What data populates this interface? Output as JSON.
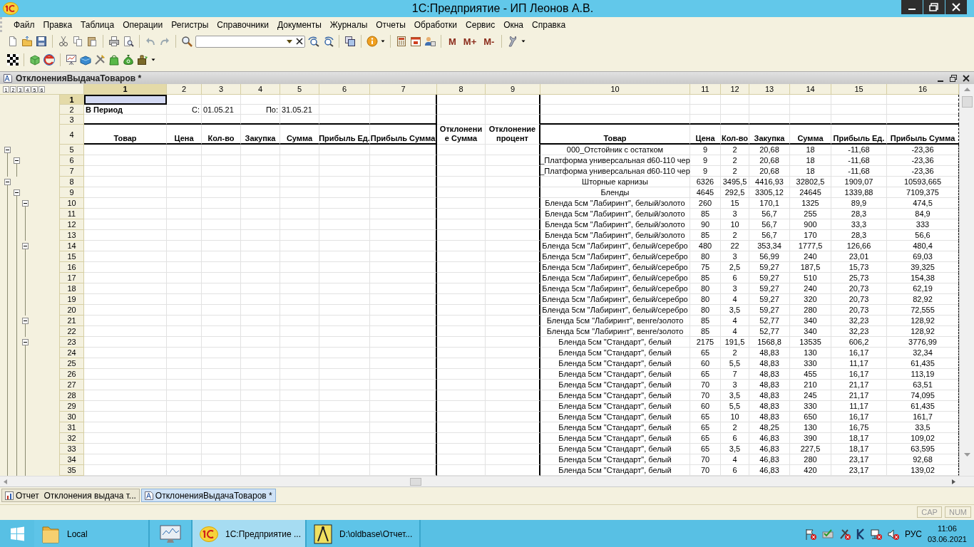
{
  "window": {
    "title": "1С:Предприятие - ИП Леонов А.В."
  },
  "menu": [
    "Файл",
    "Правка",
    "Таблица",
    "Операции",
    "Регистры",
    "Справочники",
    "Документы",
    "Журналы",
    "Отчеты",
    "Обработки",
    "Сервис",
    "Окна",
    "Справка"
  ],
  "toolbar": {
    "memory_buttons": [
      "M",
      "M+",
      "M-"
    ]
  },
  "document": {
    "title": "ОтклоненияВыдачаТоваров *",
    "outline_levels": [
      "1",
      "2",
      "3",
      "4",
      "5",
      "6"
    ],
    "columns": [
      {
        "label": "1",
        "selected": true
      },
      {
        "label": "2",
        "selected": false
      },
      {
        "label": "3",
        "selected": false
      },
      {
        "label": "4",
        "selected": false
      },
      {
        "label": "5",
        "selected": false
      },
      {
        "label": "6",
        "selected": false
      },
      {
        "label": "7",
        "selected": false
      },
      {
        "label": "8",
        "selected": false
      },
      {
        "label": "9",
        "selected": false
      },
      {
        "label": "10",
        "selected": false
      },
      {
        "label": "11",
        "selected": false
      },
      {
        "label": "12",
        "selected": false
      },
      {
        "label": "13",
        "selected": false
      },
      {
        "label": "14",
        "selected": false
      },
      {
        "label": "15",
        "selected": false
      },
      {
        "label": "16",
        "selected": false
      }
    ],
    "rows": [
      {
        "n": "1",
        "kind": "blank",
        "selected": true
      },
      {
        "n": "2",
        "kind": "period",
        "selected": false,
        "cells": {
          "1": "В Период",
          "2": "С:",
          "3": "01.05.21",
          "4": "По:",
          "5": "31.05.21"
        }
      },
      {
        "n": "3",
        "kind": "blank",
        "selected": false
      },
      {
        "n": "4",
        "kind": "header",
        "selected": false,
        "cells": {
          "1": "Товар",
          "2": "Цена",
          "3": "Кол-во",
          "4": "Закупка",
          "5": "Сумма",
          "6": "Прибыль Ед.",
          "7": "Прибыль Сумма",
          "8": "Отклонение Сумма",
          "9": "Отклонение процент",
          "10": "Товар",
          "11": "Цена",
          "12": "Кол-во",
          "13": "Закупка",
          "14": "Сумма",
          "15": "Прибыль Ед.",
          "16": "Прибыль Сумма"
        }
      },
      {
        "n": "5",
        "kind": "data",
        "selected": false,
        "cells": {
          "10": "000_Отстойник с остатком",
          "11": "9",
          "12": "2",
          "13": "20,68",
          "14": "18",
          "15": "-11,68",
          "16": "-23,36"
        },
        "expanded": true,
        "children": [
          {
            "n": "6",
            "kind": "data",
            "selected": false,
            "cells": {
              "10": "_Платформа универсальная d60-110 чер",
              "11": "9",
              "12": "2",
              "13": "20,68",
              "14": "18",
              "15": "-11,68",
              "16": "-23,36"
            },
            "expanded": true,
            "children": [
              {
                "n": "7",
                "kind": "data",
                "selected": false,
                "cells": {
                  "10": "_Платформа универсальная d60-110 чер",
                  "11": "9",
                  "12": "2",
                  "13": "20,68",
                  "14": "18",
                  "15": "-11,68",
                  "16": "-23,36"
                }
              }
            ]
          }
        ]
      },
      {
        "n": "8",
        "kind": "data",
        "selected": false,
        "cells": {
          "10": "Шторные карнизы",
          "11": "6326",
          "12": "3495,5",
          "13": "4416,93",
          "14": "32802,5",
          "15": "1909,07",
          "16": "10593,665"
        },
        "expanded": true,
        "children": [
          {
            "n": "9",
            "kind": "data",
            "selected": false,
            "cells": {
              "10": "Бленды",
              "11": "4645",
              "12": "292,5",
              "13": "3305,12",
              "14": "24645",
              "15": "1339,88",
              "16": "7109,375"
            },
            "expanded": true,
            "children": [
              {
                "n": "10",
                "kind": "data",
                "selected": false,
                "cells": {
                  "10": "Бленда 5см \"Лабиринт\", белый/золото",
                  "11": "260",
                  "12": "15",
                  "13": "170,1",
                  "14": "1325",
                  "15": "89,9",
                  "16": "474,5"
                },
                "expanded": true,
                "children": [
                  {
                    "n": "11",
                    "kind": "data",
                    "selected": false,
                    "cells": {
                      "10": "Бленда 5см \"Лабиринт\", белый/золото",
                      "11": "85",
                      "12": "3",
                      "13": "56,7",
                      "14": "255",
                      "15": "28,3",
                      "16": "84,9"
                    }
                  },
                  {
                    "n": "12",
                    "kind": "data",
                    "selected": false,
                    "cells": {
                      "10": "Бленда 5см \"Лабиринт\", белый/золото",
                      "11": "90",
                      "12": "10",
                      "13": "56,7",
                      "14": "900",
                      "15": "33,3",
                      "16": "333"
                    }
                  },
                  {
                    "n": "13",
                    "kind": "data",
                    "selected": false,
                    "cells": {
                      "10": "Бленда 5см \"Лабиринт\", белый/золото",
                      "11": "85",
                      "12": "2",
                      "13": "56,7",
                      "14": "170",
                      "15": "28,3",
                      "16": "56,6"
                    }
                  }
                ]
              },
              {
                "n": "14",
                "kind": "data",
                "selected": false,
                "cells": {
                  "10": "Бленда 5см \"Лабиринт\", белый/серебро",
                  "11": "480",
                  "12": "22",
                  "13": "353,34",
                  "14": "1777,5",
                  "15": "126,66",
                  "16": "480,4"
                },
                "expanded": true,
                "children": [
                  {
                    "n": "15",
                    "kind": "data",
                    "selected": false,
                    "cells": {
                      "10": "Бленда 5см \"Лабиринт\", белый/серебро",
                      "11": "80",
                      "12": "3",
                      "13": "56,99",
                      "14": "240",
                      "15": "23,01",
                      "16": "69,03"
                    }
                  },
                  {
                    "n": "16",
                    "kind": "data",
                    "selected": false,
                    "cells": {
                      "10": "Бленда 5см \"Лабиринт\", белый/серебро",
                      "11": "75",
                      "12": "2,5",
                      "13": "59,27",
                      "14": "187,5",
                      "15": "15,73",
                      "16": "39,325"
                    }
                  },
                  {
                    "n": "17",
                    "kind": "data",
                    "selected": false,
                    "cells": {
                      "10": "Бленда 5см \"Лабиринт\", белый/серебро",
                      "11": "85",
                      "12": "6",
                      "13": "59,27",
                      "14": "510",
                      "15": "25,73",
                      "16": "154,38"
                    }
                  },
                  {
                    "n": "18",
                    "kind": "data",
                    "selected": false,
                    "cells": {
                      "10": "Бленда 5см \"Лабиринт\", белый/серебро",
                      "11": "80",
                      "12": "3",
                      "13": "59,27",
                      "14": "240",
                      "15": "20,73",
                      "16": "62,19"
                    }
                  },
                  {
                    "n": "19",
                    "kind": "data",
                    "selected": false,
                    "cells": {
                      "10": "Бленда 5см \"Лабиринт\", белый/серебро",
                      "11": "80",
                      "12": "4",
                      "13": "59,27",
                      "14": "320",
                      "15": "20,73",
                      "16": "82,92"
                    }
                  },
                  {
                    "n": "20",
                    "kind": "data",
                    "selected": false,
                    "cells": {
                      "10": "Бленда 5см \"Лабиринт\", белый/серебро",
                      "11": "80",
                      "12": "3,5",
                      "13": "59,27",
                      "14": "280",
                      "15": "20,73",
                      "16": "72,555"
                    }
                  }
                ]
              },
              {
                "n": "21",
                "kind": "data",
                "selected": false,
                "cells": {
                  "10": "Бленда 5см \"Лабиринт\", венге/золото",
                  "11": "85",
                  "12": "4",
                  "13": "52,77",
                  "14": "340",
                  "15": "32,23",
                  "16": "128,92"
                },
                "expanded": true,
                "children": [
                  {
                    "n": "22",
                    "kind": "data",
                    "selected": false,
                    "cells": {
                      "10": "Бленда 5см \"Лабиринт\", венге/золото",
                      "11": "85",
                      "12": "4",
                      "13": "52,77",
                      "14": "340",
                      "15": "32,23",
                      "16": "128,92"
                    }
                  }
                ]
              },
              {
                "n": "23",
                "kind": "data",
                "selected": false,
                "cells": {
                  "10": "Бленда 5см \"Стандарт\", белый",
                  "11": "2175",
                  "12": "191,5",
                  "13": "1568,8",
                  "14": "13535",
                  "15": "606,2",
                  "16": "3776,99"
                },
                "expanded": true,
                "children": [
                  {
                    "n": "24",
                    "kind": "data",
                    "selected": false,
                    "cells": {
                      "10": "Бленда 5см \"Стандарт\", белый",
                      "11": "65",
                      "12": "2",
                      "13": "48,83",
                      "14": "130",
                      "15": "16,17",
                      "16": "32,34"
                    }
                  },
                  {
                    "n": "25",
                    "kind": "data",
                    "selected": false,
                    "cells": {
                      "10": "Бленда 5см \"Стандарт\", белый",
                      "11": "60",
                      "12": "5,5",
                      "13": "48,83",
                      "14": "330",
                      "15": "11,17",
                      "16": "61,435"
                    }
                  },
                  {
                    "n": "26",
                    "kind": "data",
                    "selected": false,
                    "cells": {
                      "10": "Бленда 5см \"Стандарт\", белый",
                      "11": "65",
                      "12": "7",
                      "13": "48,83",
                      "14": "455",
                      "15": "16,17",
                      "16": "113,19"
                    }
                  },
                  {
                    "n": "27",
                    "kind": "data",
                    "selected": false,
                    "cells": {
                      "10": "Бленда 5см \"Стандарт\", белый",
                      "11": "70",
                      "12": "3",
                      "13": "48,83",
                      "14": "210",
                      "15": "21,17",
                      "16": "63,51"
                    }
                  },
                  {
                    "n": "28",
                    "kind": "data",
                    "selected": false,
                    "cells": {
                      "10": "Бленда 5см \"Стандарт\", белый",
                      "11": "70",
                      "12": "3,5",
                      "13": "48,83",
                      "14": "245",
                      "15": "21,17",
                      "16": "74,095"
                    }
                  },
                  {
                    "n": "29",
                    "kind": "data",
                    "selected": false,
                    "cells": {
                      "10": "Бленда 5см \"Стандарт\", белый",
                      "11": "60",
                      "12": "5,5",
                      "13": "48,83",
                      "14": "330",
                      "15": "11,17",
                      "16": "61,435"
                    }
                  },
                  {
                    "n": "30",
                    "kind": "data",
                    "selected": false,
                    "cells": {
                      "10": "Бленда 5см \"Стандарт\", белый",
                      "11": "65",
                      "12": "10",
                      "13": "48,83",
                      "14": "650",
                      "15": "16,17",
                      "16": "161,7"
                    }
                  },
                  {
                    "n": "31",
                    "kind": "data",
                    "selected": false,
                    "cells": {
                      "10": "Бленда 5см \"Стандарт\", белый",
                      "11": "65",
                      "12": "2",
                      "13": "48,25",
                      "14": "130",
                      "15": "16,75",
                      "16": "33,5"
                    }
                  },
                  {
                    "n": "32",
                    "kind": "data",
                    "selected": false,
                    "cells": {
                      "10": "Бленда 5см \"Стандарт\", белый",
                      "11": "65",
                      "12": "6",
                      "13": "46,83",
                      "14": "390",
                      "15": "18,17",
                      "16": "109,02"
                    }
                  },
                  {
                    "n": "33",
                    "kind": "data",
                    "selected": false,
                    "cells": {
                      "10": "Бленда 5см \"Стандарт\", белый",
                      "11": "65",
                      "12": "3,5",
                      "13": "46,83",
                      "14": "227,5",
                      "15": "18,17",
                      "16": "63,595"
                    }
                  },
                  {
                    "n": "34",
                    "kind": "data",
                    "selected": false,
                    "cells": {
                      "10": "Бленда 5см \"Стандарт\", белый",
                      "11": "70",
                      "12": "4",
                      "13": "46,83",
                      "14": "280",
                      "15": "23,17",
                      "16": "92,68"
                    }
                  },
                  {
                    "n": "35",
                    "kind": "data",
                    "selected": false,
                    "cells": {
                      "10": "Бленда 5см \"Стандарт\", белый",
                      "11": "70",
                      "12": "6",
                      "13": "46,83",
                      "14": "420",
                      "15": "23,17",
                      "16": "139,02"
                    }
                  }
                ]
              }
            ]
          }
        ]
      }
    ]
  },
  "tabs": [
    {
      "label": "Отчет  Отклонения выдача т...",
      "kind": "report",
      "selected": false
    },
    {
      "label": "ОтклоненияВыдачаТоваров *",
      "kind": "sheet",
      "selected": true
    }
  ],
  "status_bar": {
    "indicators": [
      "CAP",
      "NUM"
    ]
  },
  "taskbar": {
    "buttons": [
      {
        "kind": "folder",
        "label": "Local",
        "selected": false
      },
      {
        "kind": "monitor",
        "selected": false
      },
      {
        "kind": "app",
        "label": "1С:Предприятие ...",
        "selected": true
      },
      {
        "kind": "compass",
        "label": "D:\\oldbase\\Отчет...",
        "selected": false
      }
    ],
    "language": "РУС",
    "time": "11:06",
    "date": "03.06.2021"
  }
}
